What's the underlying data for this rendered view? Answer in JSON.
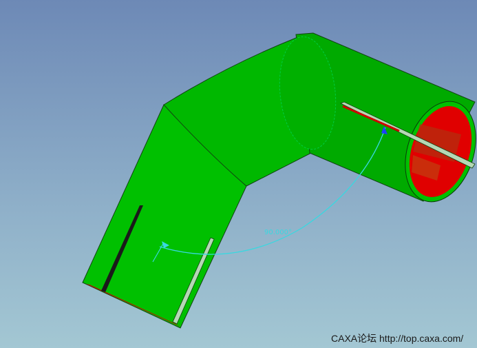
{
  "viewport": {
    "angle_dimension": "90.000°",
    "watermark": "CAXA论坛 http://top.caxa.com/",
    "colors": {
      "pipe": "#00c000",
      "interior": "#e00000",
      "dimension": "#38d8e0"
    }
  }
}
